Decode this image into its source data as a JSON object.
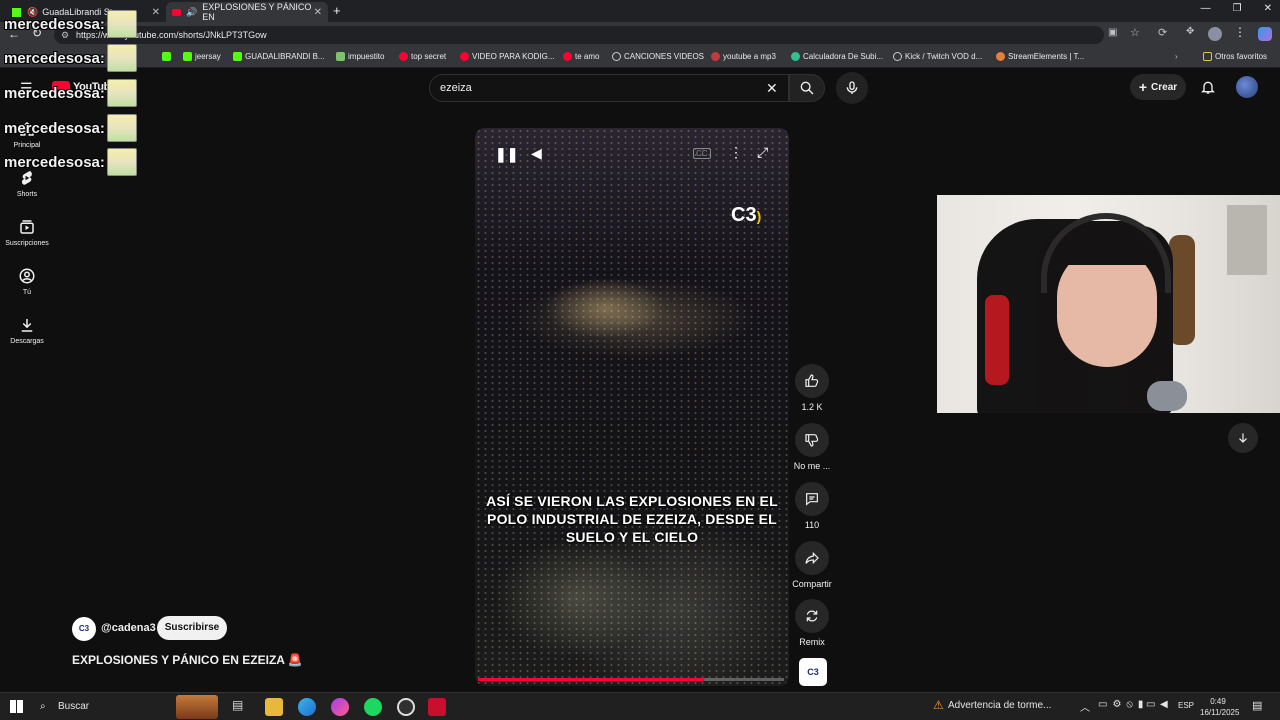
{
  "browser": {
    "tabs": [
      {
        "title": "GuadaLibrandi Stream",
        "active": false
      },
      {
        "title": "EXPLOSIONES Y PÁNICO EN",
        "active": true
      }
    ],
    "url": "https://www.youtube.com/shorts/JNkLPT3TGow",
    "bookmarks": [
      "jeersay",
      "GUADALIBRANDI B...",
      "impuestito",
      "top secret",
      "VIDEO PARA KODIG...",
      "te amo",
      "CANCIONES VIDEOS",
      "youtube a mp3",
      "Calculadora De Subi...",
      "Kick / Twitch VOD d...",
      "StreamElements | T..."
    ],
    "other_bookmarks": "Otros favoritos"
  },
  "youtube": {
    "logo": "YouTube",
    "search_value": "ezeiza",
    "create_label": "Crear",
    "sidebar": [
      {
        "label": "Principal",
        "icon": "home-icon"
      },
      {
        "label": "Shorts",
        "icon": "shorts-icon"
      },
      {
        "label": "Suscripciones",
        "icon": "subscriptions-icon"
      },
      {
        "label": "Tú",
        "icon": "you-icon"
      },
      {
        "label": "Descargas",
        "icon": "download-icon"
      }
    ],
    "video": {
      "caption": "ASÍ SE VIERON LAS EXPLOSIONES EN EL POLO INDUSTRIAL DE EZEIZA, DESDE EL SUELO Y EL CIELO",
      "watermark": "C3",
      "progress": 0.74
    },
    "actions": {
      "like_count": "1.2 K",
      "dislike_label": "No me ...",
      "comments_count": "110",
      "share_label": "Compartir",
      "remix_label": "Remix"
    },
    "channel": {
      "avatar_text": "C3",
      "handle": "@cadena3",
      "subscribe_label": "Suscribirse"
    },
    "title": "EXPLOSIONES Y PÁNICO EN EZEIZA 🚨"
  },
  "chat_overlay": [
    {
      "user": "mercedesosa:"
    },
    {
      "user": "mercedesosa:"
    },
    {
      "user": "mercedesosa:"
    },
    {
      "user": "mercedesosa:"
    },
    {
      "user": "mercedesosa:"
    }
  ],
  "taskbar": {
    "search_placeholder": "Buscar",
    "weather": "Advertencia de torme...",
    "lang": "ESP",
    "time": "0:49",
    "date": "16/11/2025"
  }
}
